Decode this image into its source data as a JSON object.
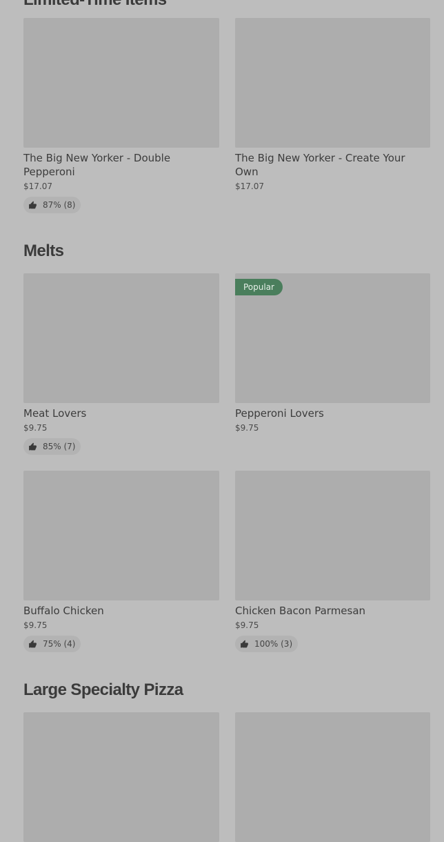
{
  "sections": [
    {
      "title": "Limited-Time Items"
    },
    {
      "title": "Melts"
    },
    {
      "title": "Large Specialty Pizza"
    }
  ],
  "items": [
    {
      "name": "The Big New Yorker - Double Pepperoni",
      "price": "$17.07",
      "rating": "87% (8)"
    },
    {
      "name": "The Big New Yorker - Create Your Own",
      "price": "$17.07",
      "rating": null
    },
    {
      "name": "Meat Lovers",
      "price": "$9.75",
      "rating": "85% (7)"
    },
    {
      "name": "Pepperoni Lovers",
      "price": "$9.75",
      "rating": null,
      "badge": "Popular"
    },
    {
      "name": "Buffalo Chicken",
      "price": "$9.75",
      "rating": "75% (4)"
    },
    {
      "name": "Chicken Bacon Parmesan",
      "price": "$9.75",
      "rating": "100% (3)"
    }
  ],
  "icons": {
    "rating": "thumbs-up-icon"
  },
  "colors": {
    "background": "#bdbdbd",
    "image_placeholder": "#adadad",
    "popular_badge": "#4a7e5c"
  }
}
